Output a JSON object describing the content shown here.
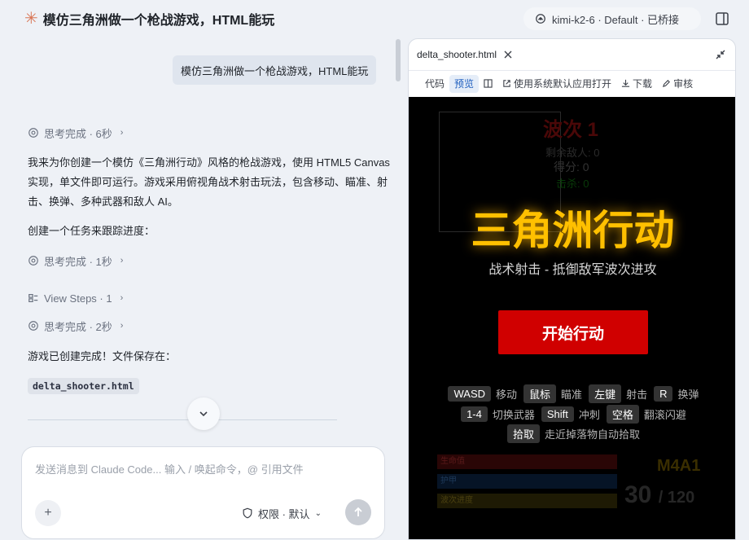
{
  "header": {
    "title": "模仿三角洲做一个枪战游戏，HTML能玩",
    "model_label": "kimi-k2-6 · Default · 已桥接"
  },
  "chat": {
    "user_message": "模仿三角洲做一个枪战游戏，HTML能玩",
    "think_1": "思考完成 · 6秒",
    "paragraph_1": "我来为你创建一个模仿《三角洲行动》风格的枪战游戏，使用 HTML5 Canvas 实现，单文件即可运行。游戏采用俯视角战术射击玩法，包含移动、瞄准、射击、换弹、多种武器和敌人 AI。",
    "paragraph_2": "创建一个任务来跟踪进度：",
    "think_2": "思考完成 · 1秒",
    "view_steps": "View Steps · 1",
    "think_3": "思考完成 · 2秒",
    "paragraph_3": "游戏已创建完成！文件保存在：",
    "file_chip": "delta_shooter.html"
  },
  "composer": {
    "placeholder": "发送消息到 Claude Code... 输入 / 唤起命令，@ 引用文件",
    "permission_label": "权限 · 默认"
  },
  "panel": {
    "file_name": "delta_shooter.html",
    "toolbar": {
      "code": "代码",
      "preview": "预览",
      "open_default": "使用系统默认应用打开",
      "download": "下载",
      "review": "审核"
    }
  },
  "game": {
    "wave": "波次 1",
    "enemies_left": "剩余敌人: 0",
    "score": "得分: 0",
    "kills": "击杀: 0",
    "title": "三角洲行动",
    "subtitle": "战术射击 - 抵御敌军波次进攻",
    "start_button": "开始行动",
    "controls": {
      "wasd_key": "WASD",
      "wasd_desc": "移动",
      "mouse_key": "鼠标",
      "mouse_desc": "瞄准",
      "lclick_key": "左键",
      "lclick_desc": "射击",
      "r_key": "R",
      "r_desc": "换弹",
      "num_key": "1-4",
      "num_desc": "切换武器",
      "shift_key": "Shift",
      "shift_desc": "冲刺",
      "space_key": "空格",
      "space_desc": "翻滚闪避",
      "pick_key": "拾取",
      "pick_desc": "走近掉落物自动拾取"
    },
    "bars": {
      "health": "生命值",
      "armor": "护甲",
      "wave_progress": "波次进度"
    },
    "weapon": "M4A1",
    "ammo": "30",
    "ammo_reserve": "/ 120"
  },
  "colors": {
    "accent_orange": "#d97757",
    "title_gold": "#ffc000",
    "start_red": "#d00000"
  }
}
